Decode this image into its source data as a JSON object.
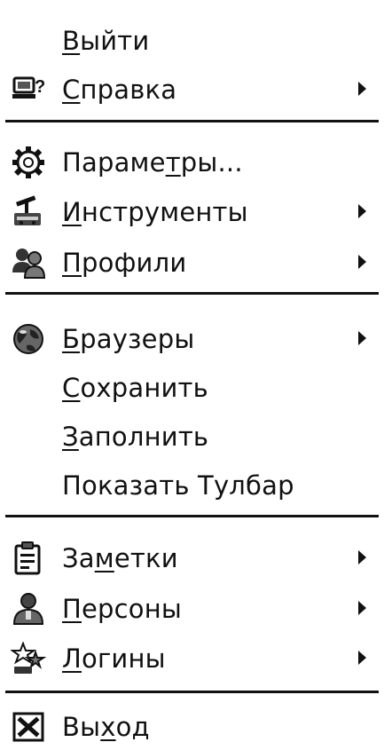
{
  "menu": {
    "items": [
      {
        "pre": "",
        "key": "В",
        "post": "ыйти",
        "icon": "none",
        "submenu": false
      },
      {
        "pre": "",
        "key": "С",
        "post": "правка",
        "icon": "help-icon",
        "submenu": true
      },
      {
        "pre": "Параме",
        "key": "т",
        "post": "ры...",
        "icon": "gear-icon",
        "submenu": false
      },
      {
        "pre": "",
        "key": "И",
        "post": "нструменты",
        "icon": "tools-icon",
        "submenu": true
      },
      {
        "pre": "",
        "key": "П",
        "post": "рофили",
        "icon": "profiles-icon",
        "submenu": true
      },
      {
        "pre": "",
        "key": "Б",
        "post": "раузеры",
        "icon": "globe-icon",
        "submenu": true
      },
      {
        "pre": "",
        "key": "С",
        "post": "охранить",
        "icon": "none",
        "submenu": false
      },
      {
        "pre": "",
        "key": "З",
        "post": "аполнить",
        "icon": "none",
        "submenu": false
      },
      {
        "pre": "Показать Тулбар",
        "key": "",
        "post": "",
        "icon": "none",
        "submenu": false
      },
      {
        "pre": "За",
        "key": "м",
        "post": "етки",
        "icon": "notes-icon",
        "submenu": true
      },
      {
        "pre": "",
        "key": "П",
        "post": "ерсоны",
        "icon": "persons-icon",
        "submenu": true
      },
      {
        "pre": "",
        "key": "Л",
        "post": "огины",
        "icon": "logins-icon",
        "submenu": true
      },
      {
        "pre": "Вы",
        "key": "х",
        "post": "од",
        "icon": "exit-icon",
        "submenu": false
      }
    ]
  }
}
